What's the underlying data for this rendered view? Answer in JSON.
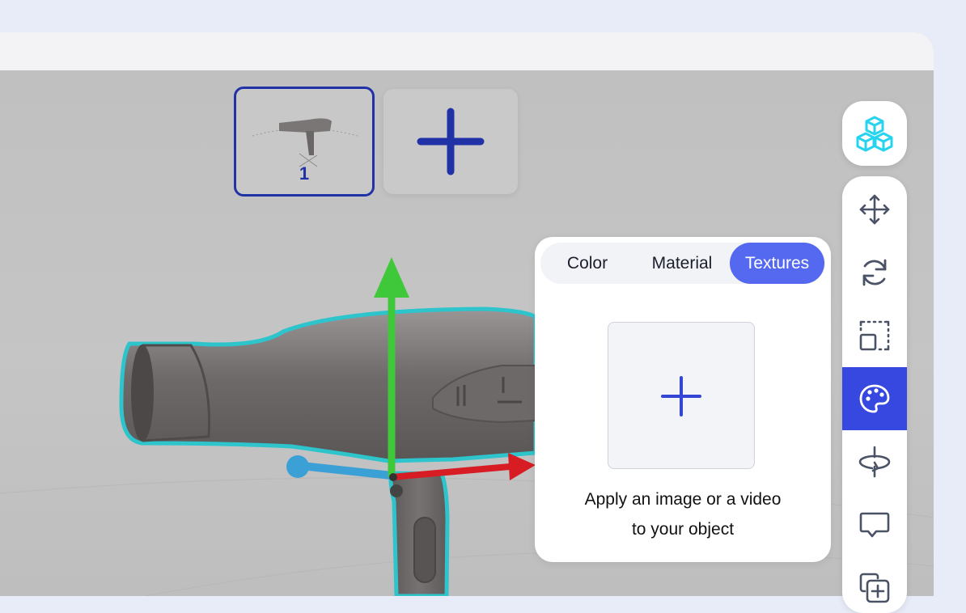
{
  "scene": {
    "thumbnail_number": "1"
  },
  "panel": {
    "tabs": [
      {
        "label": "Color"
      },
      {
        "label": "Material"
      },
      {
        "label": "Textures"
      }
    ],
    "active_tab": "Textures",
    "help_line1": "Apply an image or a video",
    "help_line2": "to your object"
  },
  "toolbar": {
    "logo_icon": "cubes-icon",
    "tools": [
      {
        "icon": "move-icon"
      },
      {
        "icon": "rotate-icon"
      },
      {
        "icon": "scale-icon"
      },
      {
        "icon": "palette-icon",
        "active": true
      },
      {
        "icon": "orbit-icon"
      },
      {
        "icon": "comment-icon"
      },
      {
        "icon": "duplicate-icon"
      }
    ]
  },
  "colors": {
    "accent": "#3748e0",
    "active_tab": "#5468f0",
    "selection_outline": "#2ec4cc",
    "axis_y": "#3fc93a",
    "axis_x": "#d81c24",
    "axis_z": "#3aa0d6",
    "thumb_border": "#2132a6",
    "logo_cyan": "#27d3ee"
  }
}
